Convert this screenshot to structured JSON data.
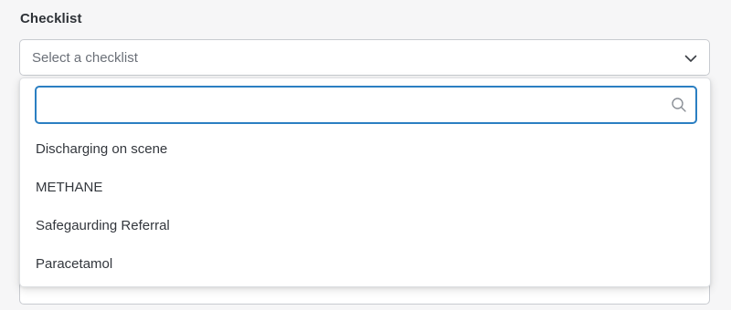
{
  "field": {
    "label": "Checklist",
    "placeholder": "Select a checklist",
    "chevron_icon": "chevron-down-icon"
  },
  "dropdown": {
    "search": {
      "value": "",
      "icon": "search-icon"
    },
    "options": [
      {
        "label": "Discharging on scene"
      },
      {
        "label": "METHANE"
      },
      {
        "label": "Safegaurding Referral"
      },
      {
        "label": "Paracetamol"
      }
    ]
  },
  "colors": {
    "focus_border": "#2b7fc2",
    "input_border": "#c8cbd0",
    "background": "#f6f6f7"
  }
}
